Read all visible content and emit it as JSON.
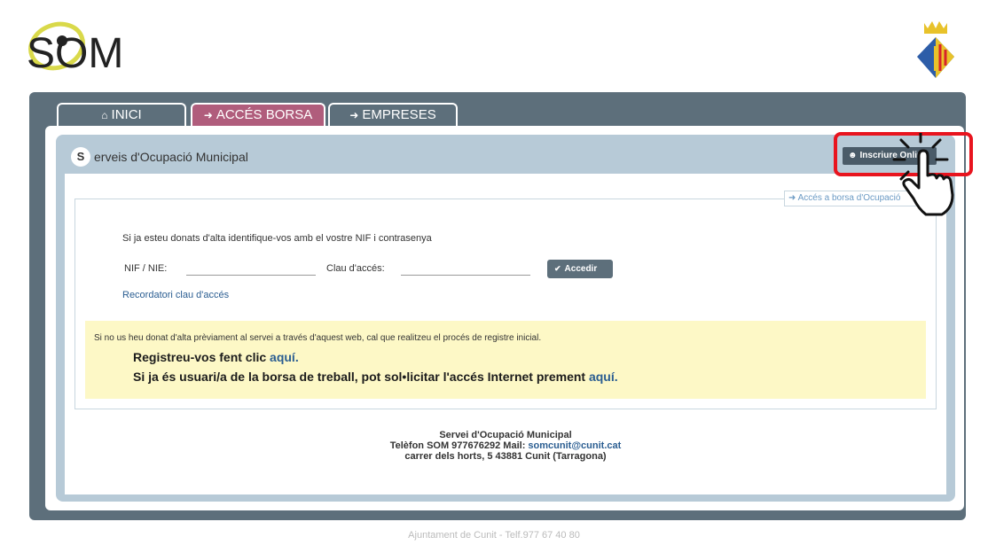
{
  "header": {
    "logo_text": "SOM"
  },
  "tabs": [
    {
      "label": "INICI"
    },
    {
      "label": "ACCÉS BORSA"
    },
    {
      "label": "EMPRESES"
    }
  ],
  "panel": {
    "title_initial": "S",
    "title_rest": "erveis d'Ocupació Municipal",
    "inscriure_label": "Inscriure Online",
    "acces_borsa_link": "Accés a borsa d'Ocupació"
  },
  "form": {
    "instructions": "Si ja esteu donats d'alta identifique-vos amb el vostre NIF i contrasenya",
    "nif_label": "NIF / NIE:",
    "nif_value": "",
    "clau_label": "Clau d'accés:",
    "clau_value": "",
    "accedir_label": "Accedir",
    "recordatori": "Recordatori clau d'accés"
  },
  "notice": {
    "text": "Si no us heu donat d'alta prèviament al servei a través d'aquest web, cal que realitzeu el procés de registre inicial.",
    "registreu_prefix": "Registreu-vos fent clic",
    "registreu_link": "aquí.",
    "usuari_prefix": "Si ja és usuari/a de la borsa de treball, pot sol•licitar l'accés Internet prement",
    "usuari_link": "aquí."
  },
  "footer": {
    "line1": "Servei d'Ocupació Municipal",
    "line2_prefix": "Telèfon SOM 977676292 Mail:",
    "email": "somcunit@cunit.cat",
    "line3": "carrer dels horts, 5 43881 Cunit (Tarragona)"
  },
  "page_footer": "Ajuntament de Cunit - Telf.977 67 40 80",
  "colors": {
    "tab_active": "#b05d7c",
    "frame": "#5d6f7b",
    "highlight": "#e8141e",
    "link": "#2a5d91",
    "notice_bg": "#fdf8c6"
  },
  "icons": {
    "home": "home-icon",
    "login": "sign-in-icon",
    "user_add": "user-plus-icon",
    "check": "check-circle-icon"
  }
}
